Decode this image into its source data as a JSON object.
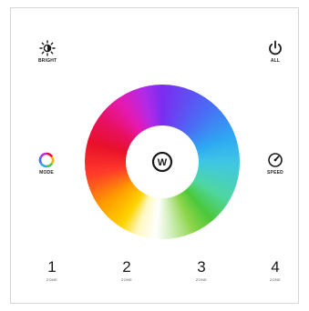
{
  "controls": {
    "bright": {
      "label": "BRIGHT",
      "icon": "sun-brightness-icon"
    },
    "all": {
      "label": "ALL",
      "icon": "power-icon"
    },
    "mode": {
      "label": "MODE",
      "icon": "color-ring-icon"
    },
    "speed": {
      "label": "SPEED",
      "icon": "speedometer-icon"
    }
  },
  "wheel": {
    "center_button": "W",
    "icon": "color-wheel"
  },
  "zones": [
    {
      "number": "1",
      "label": "ZONE"
    },
    {
      "number": "2",
      "label": "ZONE"
    },
    {
      "number": "3",
      "label": "ZONE"
    },
    {
      "number": "4",
      "label": "ZONE"
    }
  ],
  "colors": {
    "panel": "#ffffff",
    "border": "#d6d6d6",
    "icon": "#1a1a1a"
  }
}
